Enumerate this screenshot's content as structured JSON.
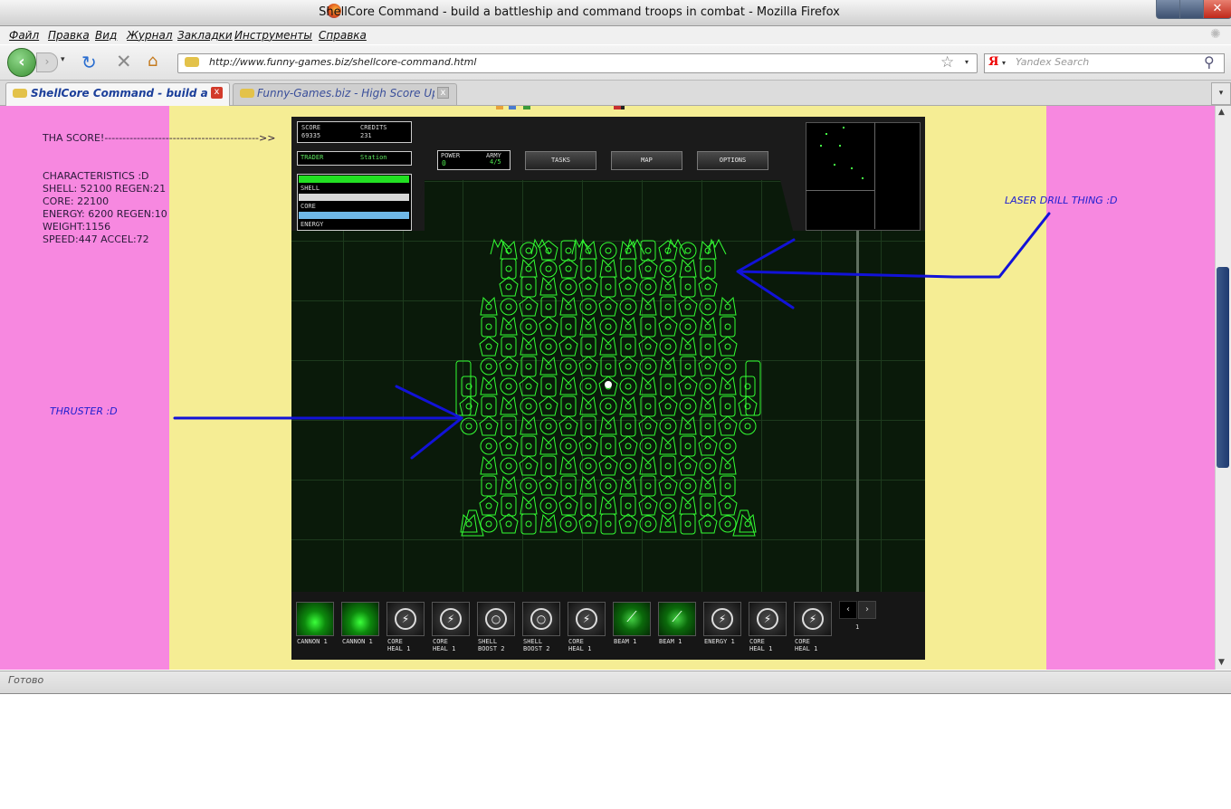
{
  "window": {
    "title": "ShellCore Command - build a battleship and command troops in combat - Mozilla Firefox",
    "close_glyph": "✕"
  },
  "menu": {
    "items": [
      "Файл",
      "Правка",
      "Вид",
      "Журнал",
      "Закладки",
      "Инструменты",
      "Справка"
    ]
  },
  "navbar": {
    "back_glyph": "‹",
    "forward_glyph": "›",
    "dropdown_glyph": "▾",
    "reload_glyph": "↻",
    "stop_glyph": "✕",
    "home_glyph": "⌂",
    "url": "http://www.funny-games.biz/shellcore-command.html",
    "bookmark_glyph": "☆",
    "search_engine_logo": "Я",
    "search_placeholder": "Yandex Search",
    "search_glyph": "⚲"
  },
  "tabs": [
    {
      "label": "ShellCore Command - build a battleship and command troops in combat",
      "active": true,
      "close_glyph": "x"
    },
    {
      "label": "Funny-Games.biz - High Score Upload",
      "active": false,
      "close_glyph": "x"
    }
  ],
  "tab_list_glyph": "▾",
  "annotations": {
    "score_note": "THA SCORE!------------------------------------------->>",
    "characteristics": "CHARACTERISTICS :D\nSHELL: 52100 REGEN:21\nCORE: 22100\nENERGY: 6200 REGEN:10\nWEIGHT:1156\nSPEED:447 ACCEL:72",
    "thruster_label": "THRUSTER :D",
    "laser_label": "LASER DRILL THING :D",
    "arrow_color": "#1212d8"
  },
  "game": {
    "score_label": "SCORE",
    "score_value": "69335",
    "credits_label": "CREDITS",
    "credits_value": "231",
    "trader_label": "TRADER",
    "trader_value": "Station",
    "bars": [
      {
        "label": "SHELL",
        "color": "#22e022",
        "fill": 1.0
      },
      {
        "label": "CORE",
        "color": "#d8d8d8",
        "fill": 1.0
      },
      {
        "label": "ENERGY",
        "color": "#6fb8e8",
        "fill": 1.0
      }
    ],
    "power_label": "POWER",
    "power_value": "0",
    "army_label": "ARMY",
    "army_value": "4/5",
    "buttons": [
      "TASKS",
      "MAP",
      "OPTIONS"
    ],
    "ship_color": "#33ff33",
    "parts": [
      {
        "line1": "CANNON 1",
        "line2": "",
        "style": "green-glow",
        "icon": ""
      },
      {
        "line1": "CANNON 1",
        "line2": "",
        "style": "green-glow",
        "icon": ""
      },
      {
        "line1": "CORE",
        "line2": "HEAL 1",
        "style": "dark",
        "icon": "⚡"
      },
      {
        "line1": "CORE",
        "line2": "HEAL 1",
        "style": "dark",
        "icon": "⚡"
      },
      {
        "line1": "SHELL",
        "line2": "BOOST 2",
        "style": "dark",
        "icon": "○"
      },
      {
        "line1": "SHELL",
        "line2": "BOOST 2",
        "style": "dark",
        "icon": "○"
      },
      {
        "line1": "CORE",
        "line2": "HEAL 1",
        "style": "dark",
        "icon": "⚡"
      },
      {
        "line1": "BEAM 1",
        "line2": "",
        "style": "green",
        "icon": "⟋"
      },
      {
        "line1": "BEAM 1",
        "line2": "",
        "style": "green",
        "icon": "⟋"
      },
      {
        "line1": "ENERGY 1",
        "line2": "",
        "style": "dark",
        "icon": "⚡"
      },
      {
        "line1": "CORE",
        "line2": "HEAL 1",
        "style": "dark",
        "icon": "⚡"
      },
      {
        "line1": "CORE",
        "line2": "HEAL 1",
        "style": "dark",
        "icon": "⚡"
      }
    ],
    "page_prev_glyph": "‹",
    "page_next_glyph": "›",
    "page_number": "1"
  },
  "status": {
    "text": "Готово"
  }
}
